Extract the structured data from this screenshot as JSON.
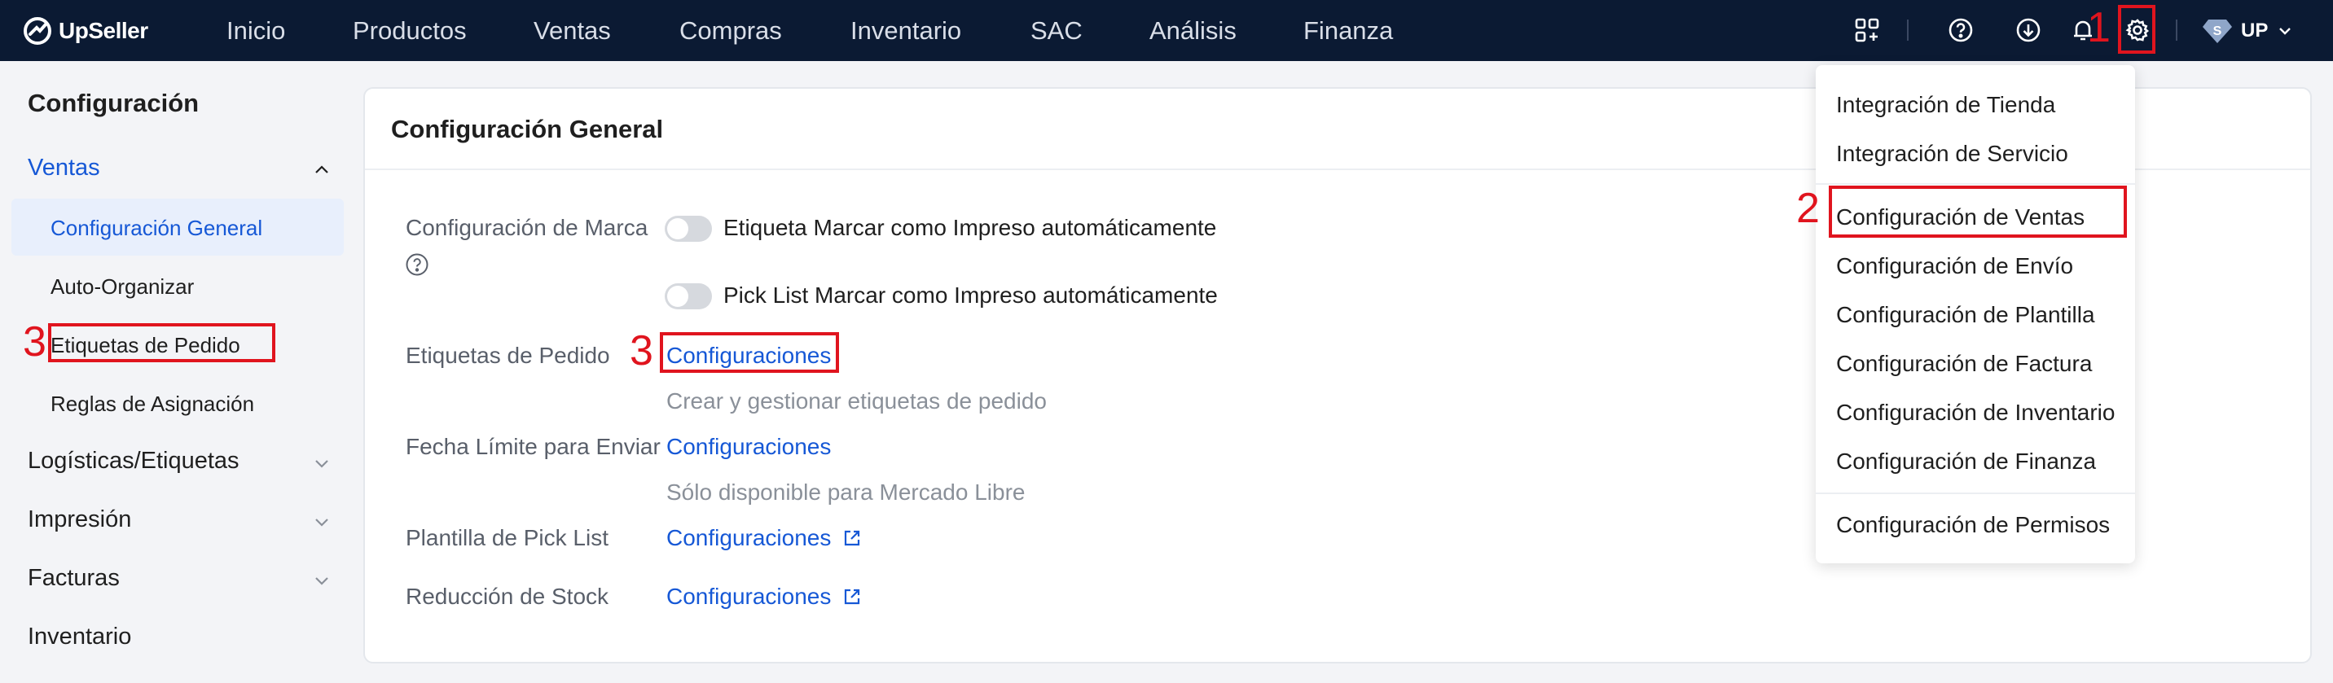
{
  "topbar": {
    "logo_text": "UpSeller",
    "nav": [
      "Inicio",
      "Productos",
      "Ventas",
      "Compras",
      "Inventario",
      "SAC",
      "Análisis",
      "Finanza"
    ],
    "user_label": "UP",
    "avatar_letter": "S",
    "icons": [
      "apps-grid-icon",
      "help-icon",
      "download-icon",
      "bell-icon",
      "gear-icon"
    ]
  },
  "sidebar": {
    "title": "Configuración",
    "groups": [
      {
        "label": "Ventas",
        "expanded": true
      },
      {
        "label": "Logísticas/Etiquetas",
        "expanded": false
      },
      {
        "label": "Impresión",
        "expanded": false
      },
      {
        "label": "Facturas",
        "expanded": false
      },
      {
        "label": "Inventario",
        "expanded": false
      }
    ],
    "ventas_items": [
      "Configuración General",
      "Auto-Organizar",
      "Etiquetas de Pedido",
      "Reglas de Asignación"
    ]
  },
  "main": {
    "title": "Configuración General",
    "brand_label": "Configuración de Marca",
    "toggle1_label": "Etiqueta Marcar como Impreso automáticamente",
    "toggle2_label": "Pick List Marcar como Impreso automáticamente",
    "order_tags_label": "Etiquetas de Pedido",
    "order_tags_link": "Configuraciones",
    "order_tags_hint": "Crear y gestionar etiquetas de pedido",
    "deadline_label": "Fecha Límite para Enviar",
    "deadline_link": "Configuraciones",
    "deadline_hint": "Sólo disponible para Mercado Libre",
    "picklist_label": "Plantilla de Pick List",
    "picklist_link": "Configuraciones",
    "stock_label": "Reducción de Stock",
    "stock_link": "Configuraciones"
  },
  "dropdown": {
    "items": [
      "Integración de Tienda",
      "Integración de Servicio",
      "Configuración de Ventas",
      "Configuración de Envío",
      "Configuración de Plantilla",
      "Configuración de Factura",
      "Configuración de Inventario",
      "Configuración de Finanza",
      "Configuración de Permisos"
    ]
  },
  "annotations": {
    "n1": "1",
    "n2": "2",
    "n3": "3"
  },
  "colors": {
    "nav_bg": "#0b1a33",
    "accent": "#1658d6",
    "annotation": "#e0141e"
  }
}
